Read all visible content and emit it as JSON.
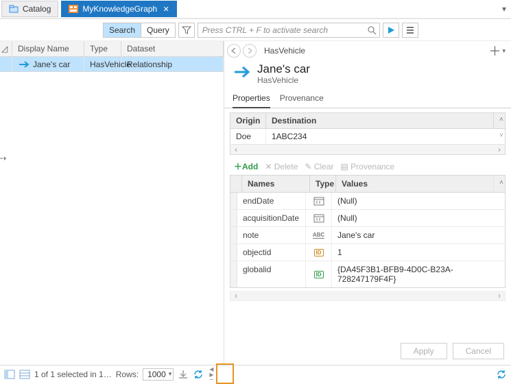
{
  "tabs": {
    "catalog": "Catalog",
    "active": "MyKnowledgeGraph"
  },
  "toolbar": {
    "segment": {
      "search": "Search",
      "query": "Query"
    },
    "placeholder": "Press CTRL + F to activate search"
  },
  "grid": {
    "headers": {
      "displayName": "Display Name",
      "type": "Type",
      "dataset": "Dataset"
    },
    "row": {
      "displayName": "Jane's car",
      "type": "HasVehicle",
      "dataset": "Relationship"
    }
  },
  "detail": {
    "breadcrumb": "HasVehicle",
    "title": "Jane's car",
    "subtitle": "HasVehicle",
    "tabs": {
      "properties": "Properties",
      "provenance": "Provenance"
    },
    "od": {
      "headers": {
        "origin": "Origin",
        "destination": "Destination"
      },
      "row": {
        "origin": "Doe",
        "destination": "1ABC234"
      }
    },
    "propToolbar": {
      "add": "Add",
      "delete": "Delete",
      "clear": "Clear",
      "provenance": "Provenance"
    },
    "propHeaders": {
      "names": "Names",
      "type": "Type",
      "values": "Values"
    },
    "props": [
      {
        "name": "endDate",
        "typeIcon": "date",
        "value": "(Null)"
      },
      {
        "name": "acquisitionDate",
        "typeIcon": "date",
        "value": "(Null)"
      },
      {
        "name": "note",
        "typeIcon": "abc",
        "value": "Jane's car"
      },
      {
        "name": "objectid",
        "typeIcon": "oid",
        "value": "1"
      },
      {
        "name": "globalid",
        "typeIcon": "gid",
        "value": "{DA45F3B1-BFB9-4D0C-B23A-728247179F4F}"
      }
    ],
    "buttons": {
      "apply": "Apply",
      "cancel": "Cancel"
    }
  },
  "status": {
    "selection": "1 of 1 selected in 1…",
    "rowsLabel": "Rows:",
    "rowsValue": "1000"
  }
}
